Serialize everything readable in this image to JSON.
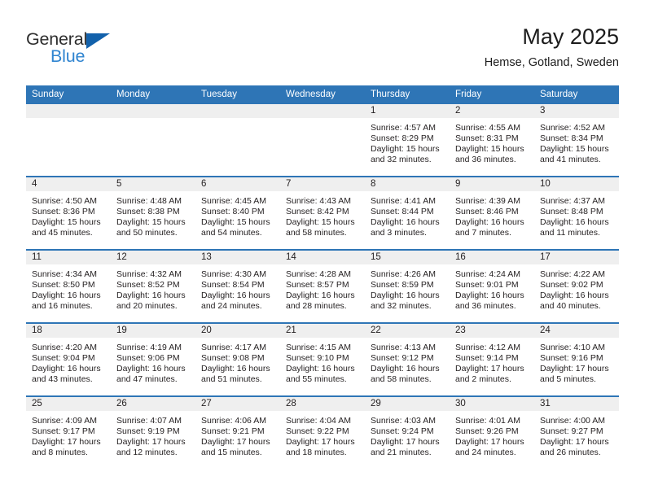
{
  "logo": {
    "primary_text": "General",
    "secondary_text": "Blue",
    "primary_color": "#2e2e2e",
    "secondary_color": "#2f84d0",
    "triangle_color": "#1261ab"
  },
  "header": {
    "title": "May 2025",
    "location": "Hemse, Gotland, Sweden"
  },
  "theme": {
    "header_bg": "#2e75b6",
    "header_text": "#ffffff",
    "daynum_strip_bg": "#efefef",
    "body_text": "#231f20",
    "page_bg": "#ffffff"
  },
  "weekdays": [
    "Sunday",
    "Monday",
    "Tuesday",
    "Wednesday",
    "Thursday",
    "Friday",
    "Saturday"
  ],
  "labels": {
    "sunrise_prefix": "Sunrise:",
    "sunset_prefix": "Sunset:",
    "daylight_prefix": "Daylight:"
  },
  "weeks": [
    [
      {
        "day": "",
        "empty": true
      },
      {
        "day": "",
        "empty": true
      },
      {
        "day": "",
        "empty": true
      },
      {
        "day": "",
        "empty": true
      },
      {
        "day": "1",
        "sunrise": "Sunrise: 4:57 AM",
        "sunset": "Sunset: 8:29 PM",
        "daylight": "Daylight: 15 hours and 32 minutes."
      },
      {
        "day": "2",
        "sunrise": "Sunrise: 4:55 AM",
        "sunset": "Sunset: 8:31 PM",
        "daylight": "Daylight: 15 hours and 36 minutes."
      },
      {
        "day": "3",
        "sunrise": "Sunrise: 4:52 AM",
        "sunset": "Sunset: 8:34 PM",
        "daylight": "Daylight: 15 hours and 41 minutes."
      }
    ],
    [
      {
        "day": "4",
        "sunrise": "Sunrise: 4:50 AM",
        "sunset": "Sunset: 8:36 PM",
        "daylight": "Daylight: 15 hours and 45 minutes."
      },
      {
        "day": "5",
        "sunrise": "Sunrise: 4:48 AM",
        "sunset": "Sunset: 8:38 PM",
        "daylight": "Daylight: 15 hours and 50 minutes."
      },
      {
        "day": "6",
        "sunrise": "Sunrise: 4:45 AM",
        "sunset": "Sunset: 8:40 PM",
        "daylight": "Daylight: 15 hours and 54 minutes."
      },
      {
        "day": "7",
        "sunrise": "Sunrise: 4:43 AM",
        "sunset": "Sunset: 8:42 PM",
        "daylight": "Daylight: 15 hours and 58 minutes."
      },
      {
        "day": "8",
        "sunrise": "Sunrise: 4:41 AM",
        "sunset": "Sunset: 8:44 PM",
        "daylight": "Daylight: 16 hours and 3 minutes."
      },
      {
        "day": "9",
        "sunrise": "Sunrise: 4:39 AM",
        "sunset": "Sunset: 8:46 PM",
        "daylight": "Daylight: 16 hours and 7 minutes."
      },
      {
        "day": "10",
        "sunrise": "Sunrise: 4:37 AM",
        "sunset": "Sunset: 8:48 PM",
        "daylight": "Daylight: 16 hours and 11 minutes."
      }
    ],
    [
      {
        "day": "11",
        "sunrise": "Sunrise: 4:34 AM",
        "sunset": "Sunset: 8:50 PM",
        "daylight": "Daylight: 16 hours and 16 minutes."
      },
      {
        "day": "12",
        "sunrise": "Sunrise: 4:32 AM",
        "sunset": "Sunset: 8:52 PM",
        "daylight": "Daylight: 16 hours and 20 minutes."
      },
      {
        "day": "13",
        "sunrise": "Sunrise: 4:30 AM",
        "sunset": "Sunset: 8:54 PM",
        "daylight": "Daylight: 16 hours and 24 minutes."
      },
      {
        "day": "14",
        "sunrise": "Sunrise: 4:28 AM",
        "sunset": "Sunset: 8:57 PM",
        "daylight": "Daylight: 16 hours and 28 minutes."
      },
      {
        "day": "15",
        "sunrise": "Sunrise: 4:26 AM",
        "sunset": "Sunset: 8:59 PM",
        "daylight": "Daylight: 16 hours and 32 minutes."
      },
      {
        "day": "16",
        "sunrise": "Sunrise: 4:24 AM",
        "sunset": "Sunset: 9:01 PM",
        "daylight": "Daylight: 16 hours and 36 minutes."
      },
      {
        "day": "17",
        "sunrise": "Sunrise: 4:22 AM",
        "sunset": "Sunset: 9:02 PM",
        "daylight": "Daylight: 16 hours and 40 minutes."
      }
    ],
    [
      {
        "day": "18",
        "sunrise": "Sunrise: 4:20 AM",
        "sunset": "Sunset: 9:04 PM",
        "daylight": "Daylight: 16 hours and 43 minutes."
      },
      {
        "day": "19",
        "sunrise": "Sunrise: 4:19 AM",
        "sunset": "Sunset: 9:06 PM",
        "daylight": "Daylight: 16 hours and 47 minutes."
      },
      {
        "day": "20",
        "sunrise": "Sunrise: 4:17 AM",
        "sunset": "Sunset: 9:08 PM",
        "daylight": "Daylight: 16 hours and 51 minutes."
      },
      {
        "day": "21",
        "sunrise": "Sunrise: 4:15 AM",
        "sunset": "Sunset: 9:10 PM",
        "daylight": "Daylight: 16 hours and 55 minutes."
      },
      {
        "day": "22",
        "sunrise": "Sunrise: 4:13 AM",
        "sunset": "Sunset: 9:12 PM",
        "daylight": "Daylight: 16 hours and 58 minutes."
      },
      {
        "day": "23",
        "sunrise": "Sunrise: 4:12 AM",
        "sunset": "Sunset: 9:14 PM",
        "daylight": "Daylight: 17 hours and 2 minutes."
      },
      {
        "day": "24",
        "sunrise": "Sunrise: 4:10 AM",
        "sunset": "Sunset: 9:16 PM",
        "daylight": "Daylight: 17 hours and 5 minutes."
      }
    ],
    [
      {
        "day": "25",
        "sunrise": "Sunrise: 4:09 AM",
        "sunset": "Sunset: 9:17 PM",
        "daylight": "Daylight: 17 hours and 8 minutes."
      },
      {
        "day": "26",
        "sunrise": "Sunrise: 4:07 AM",
        "sunset": "Sunset: 9:19 PM",
        "daylight": "Daylight: 17 hours and 12 minutes."
      },
      {
        "day": "27",
        "sunrise": "Sunrise: 4:06 AM",
        "sunset": "Sunset: 9:21 PM",
        "daylight": "Daylight: 17 hours and 15 minutes."
      },
      {
        "day": "28",
        "sunrise": "Sunrise: 4:04 AM",
        "sunset": "Sunset: 9:22 PM",
        "daylight": "Daylight: 17 hours and 18 minutes."
      },
      {
        "day": "29",
        "sunrise": "Sunrise: 4:03 AM",
        "sunset": "Sunset: 9:24 PM",
        "daylight": "Daylight: 17 hours and 21 minutes."
      },
      {
        "day": "30",
        "sunrise": "Sunrise: 4:01 AM",
        "sunset": "Sunset: 9:26 PM",
        "daylight": "Daylight: 17 hours and 24 minutes."
      },
      {
        "day": "31",
        "sunrise": "Sunrise: 4:00 AM",
        "sunset": "Sunset: 9:27 PM",
        "daylight": "Daylight: 17 hours and 26 minutes."
      }
    ]
  ]
}
